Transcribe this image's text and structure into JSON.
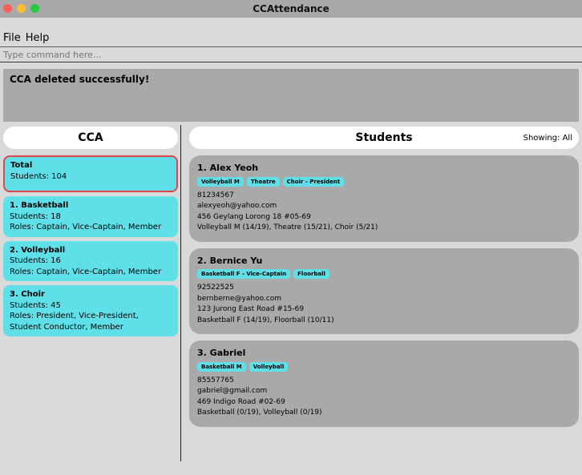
{
  "window": {
    "title": "CCAttendance"
  },
  "menu": {
    "file": "File",
    "help": "Help"
  },
  "command": {
    "placeholder": "Type command here..."
  },
  "result": {
    "message": "CCA deleted successfully!"
  },
  "cca_panel": {
    "header": "CCA",
    "total": {
      "label": "Total",
      "students": "Students: 104"
    },
    "items": [
      {
        "name": "1. Basketball",
        "students": "Students: 18",
        "roles": "Roles: Captain, Vice-Captain, Member"
      },
      {
        "name": "2. Volleyball",
        "students": "Students: 16",
        "roles": "Roles: Captain, Vice-Captain, Member"
      },
      {
        "name": "3. Choir",
        "students": "Students: 45",
        "roles": "Roles: President, Vice-President, Student Conductor, Member"
      }
    ]
  },
  "students_panel": {
    "header": "Students",
    "showing": "Showing: All",
    "students": [
      {
        "name": "1. Alex Yeoh",
        "tags": [
          "Volleyball M",
          "Theatre",
          "Choir - President"
        ],
        "phone": "81234567",
        "email": "alexyeoh@yahoo.com",
        "address": "456 Geylang Lorong 18 #05-69",
        "attendance": "Volleyball M (14/19), Theatre (15/21), Choir (5/21)"
      },
      {
        "name": "2. Bernice Yu",
        "tags": [
          "Basketball F - Vice-Captain",
          "Floorball"
        ],
        "phone": "92522525",
        "email": "bernberne@yahoo.com",
        "address": "123 Jurong East Road #15-69",
        "attendance": "Basketball F (14/19), Floorball (10/11)"
      },
      {
        "name": "3. Gabriel",
        "tags": [
          "Basketball M",
          "Volleyball"
        ],
        "phone": "85557765",
        "email": "gabriel@gmail.com",
        "address": "469 Indigo Road #02-69",
        "attendance": "Basketball (0/19), Volleyball (0/19)"
      }
    ]
  },
  "colors": {
    "accent": "#5fe0e8",
    "selected_border": "#e0474c",
    "card_gray": "#a9a9a9"
  }
}
